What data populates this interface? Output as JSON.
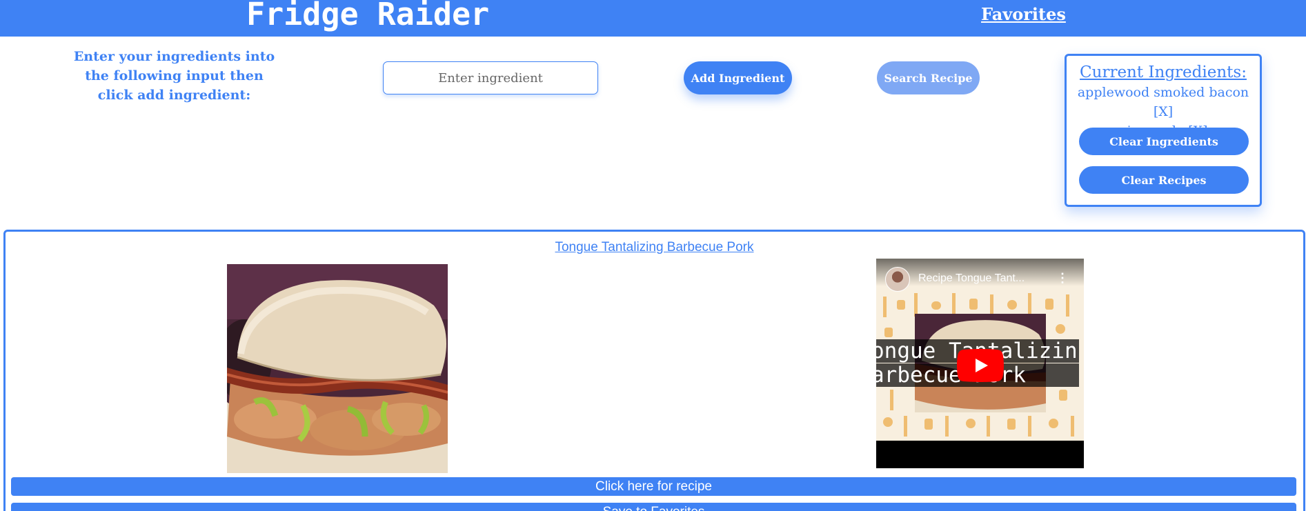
{
  "header": {
    "title": "Fridge Raider",
    "favorites_link": "Favorites"
  },
  "form": {
    "instruction": "Enter your ingredients into the following input then click add ingredient:",
    "input_placeholder": "Enter ingredient",
    "add_button": "Add Ingredient",
    "search_button": "Search Recipe"
  },
  "ingredients_panel": {
    "heading": "Current Ingredients:",
    "items": [
      "applewood smoked bacon [X]",
      "pineapple [X]"
    ],
    "clear_ingredients_button": "Clear Ingredients",
    "clear_recipes_button": "Clear Recipes"
  },
  "recipe": {
    "title": "Tongue Tantalizing Barbecue Pork",
    "video": {
      "title": "Recipe Tongue Tant...",
      "banner_line_1": "ongue Tantalizin",
      "banner_line_2": "arbecue Pork"
    },
    "recipe_button": "Click here for recipe",
    "favorites_button": "Save to Favorites"
  },
  "colors": {
    "primary": "#3f82f4",
    "search_button": "#7fa8f4",
    "youtube_red": "#ff0000"
  }
}
